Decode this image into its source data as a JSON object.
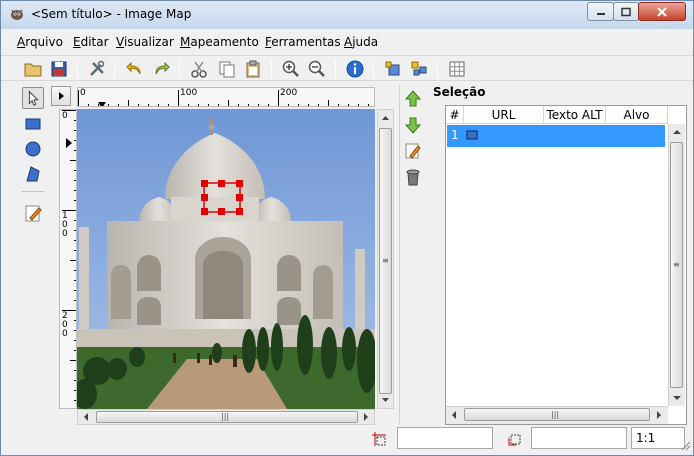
{
  "window": {
    "title": "<Sem título> - Image Map"
  },
  "menu": {
    "items": [
      {
        "label": "Arquivo"
      },
      {
        "label": "Editar"
      },
      {
        "label": "Visualizar"
      },
      {
        "label": "Mapeamento"
      },
      {
        "label": "Ferramentas"
      },
      {
        "label": "Ajuda"
      }
    ]
  },
  "toolbar": {
    "icons": [
      "open-icon",
      "save-icon",
      "preferences-icon",
      "undo-icon",
      "redo-icon",
      "cut-icon",
      "copy-icon",
      "paste-icon",
      "zoom-in-icon",
      "zoom-out-icon",
      "info-icon",
      "edit-area-info-icon",
      "edit-map-info-icon",
      "grid-icon"
    ]
  },
  "ruler": {
    "h_ticks": [
      "0",
      "100",
      "200"
    ],
    "v_ticks": [
      "0",
      "100",
      "200"
    ]
  },
  "selection": {
    "title": "Seleção",
    "columns": [
      "#",
      "URL",
      "Texto ALT",
      "Alvo"
    ],
    "rows": [
      {
        "num": "1",
        "url": "",
        "alt": "",
        "target": ""
      }
    ]
  },
  "status": {
    "zoom": "1:1"
  },
  "colors": {
    "selection_row": "#3399ff",
    "handle": "#e00000",
    "sky": "#8fb0e0"
  }
}
